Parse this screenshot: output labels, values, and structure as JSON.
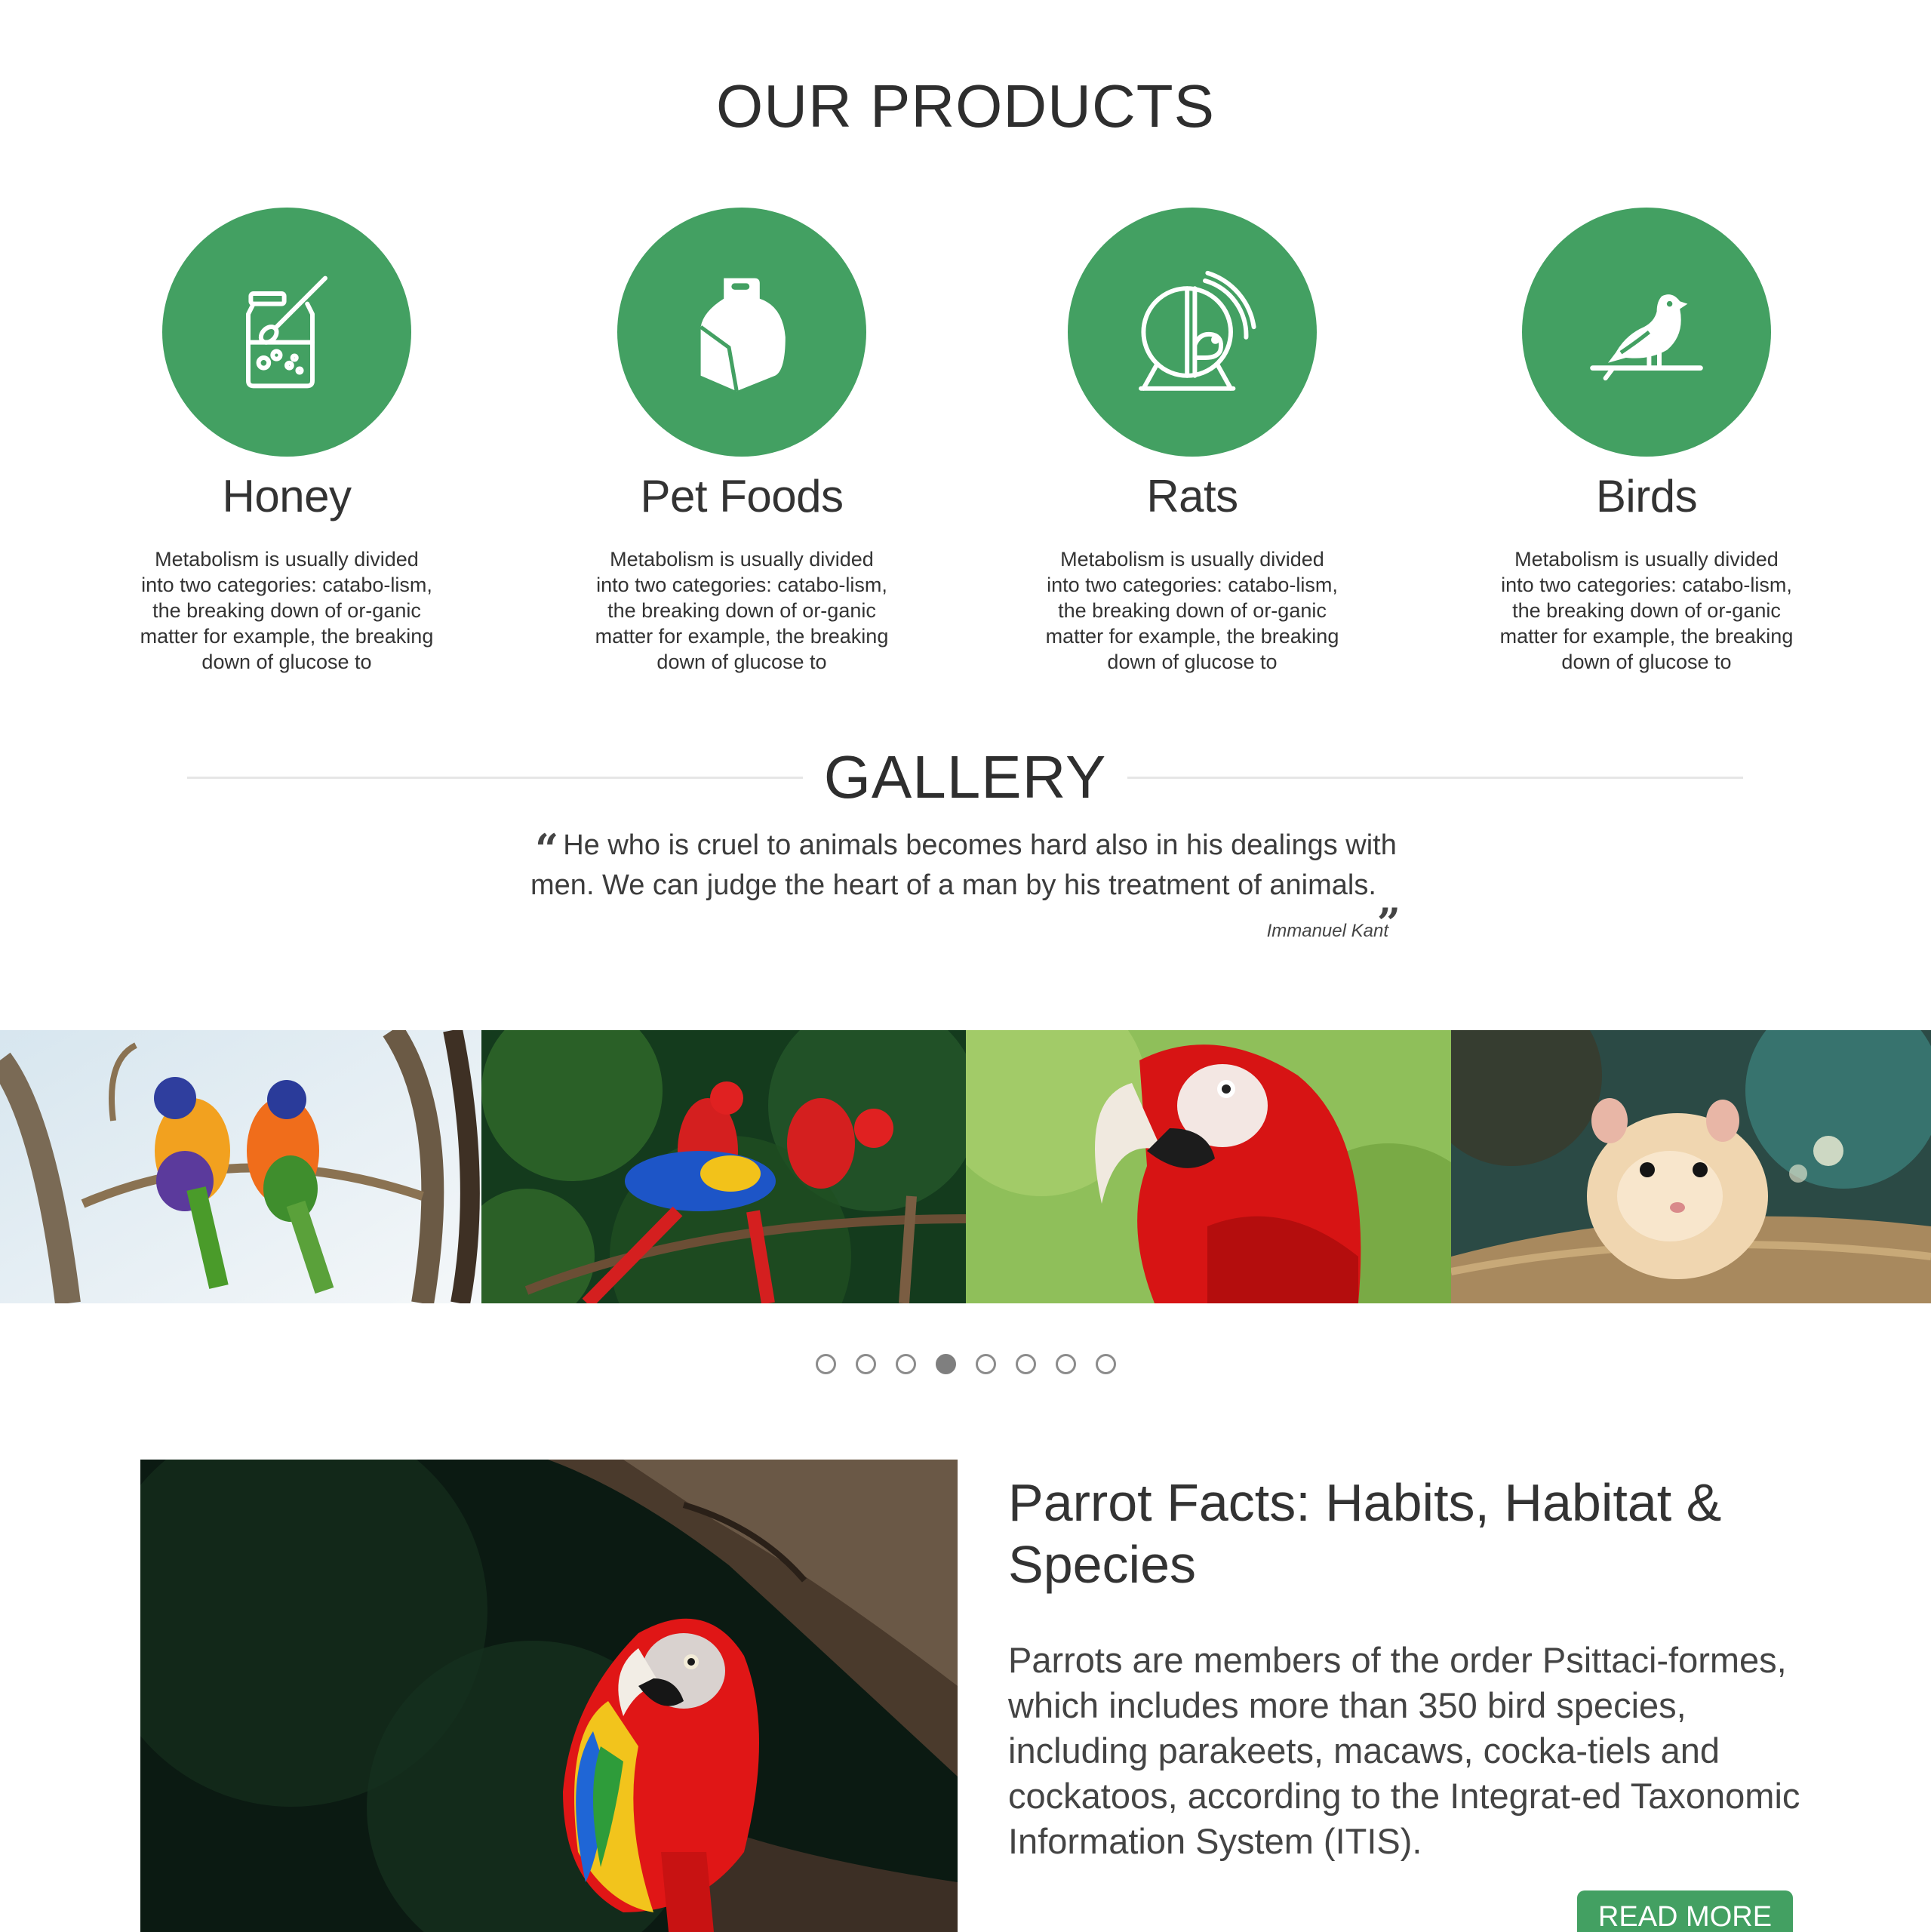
{
  "products": {
    "title": "OUR PRODUCTS",
    "items": [
      {
        "name": "Honey",
        "icon": "honey-jar-icon",
        "desc": "Metabolism is usually divided into two categories: catabo-lism, the breaking down of or-ganic matter for example, the breaking down of glucose to"
      },
      {
        "name": "Pet Foods",
        "icon": "food-bag-icon",
        "desc": "Metabolism is usually divided into two categories: catabo-lism, the breaking down of or-ganic matter for example, the breaking down of glucose to"
      },
      {
        "name": "Rats",
        "icon": "hamster-wheel-icon",
        "desc": "Metabolism is usually divided into two categories: catabo-lism, the breaking down of or-ganic matter for example, the breaking down of glucose to"
      },
      {
        "name": "Birds",
        "icon": "bird-on-branch-icon",
        "desc": "Metabolism is usually divided into two categories: catabo-lism, the breaking down of or-ganic matter for example, the breaking down of glucose to"
      }
    ]
  },
  "gallery": {
    "title": "GALLERY",
    "quote": {
      "open_mark": "“",
      "text": "He who is cruel to animals becomes hard also in his dealings with men. We can judge the heart of a man by his treatment of animals.",
      "close_mark": "„",
      "author": "Immanuel Kant"
    },
    "slide_count": 8,
    "active_slide": 4
  },
  "article": {
    "title": "Parrot Facts: Habits, Habitat & Species",
    "body": "Parrots are members of the order Psittaci-formes, which includes more than 350 bird species, including parakeets, macaws, cocka-tiels and cockatoos, according to the Integrat-ed Taxonomic Information System (ITIS).",
    "button_label": "READ MORE"
  },
  "colors": {
    "accent_green": "#43a062",
    "text_dark": "#333333",
    "rule": "#e6e6e6",
    "dot_active": "#7f7f7f"
  }
}
